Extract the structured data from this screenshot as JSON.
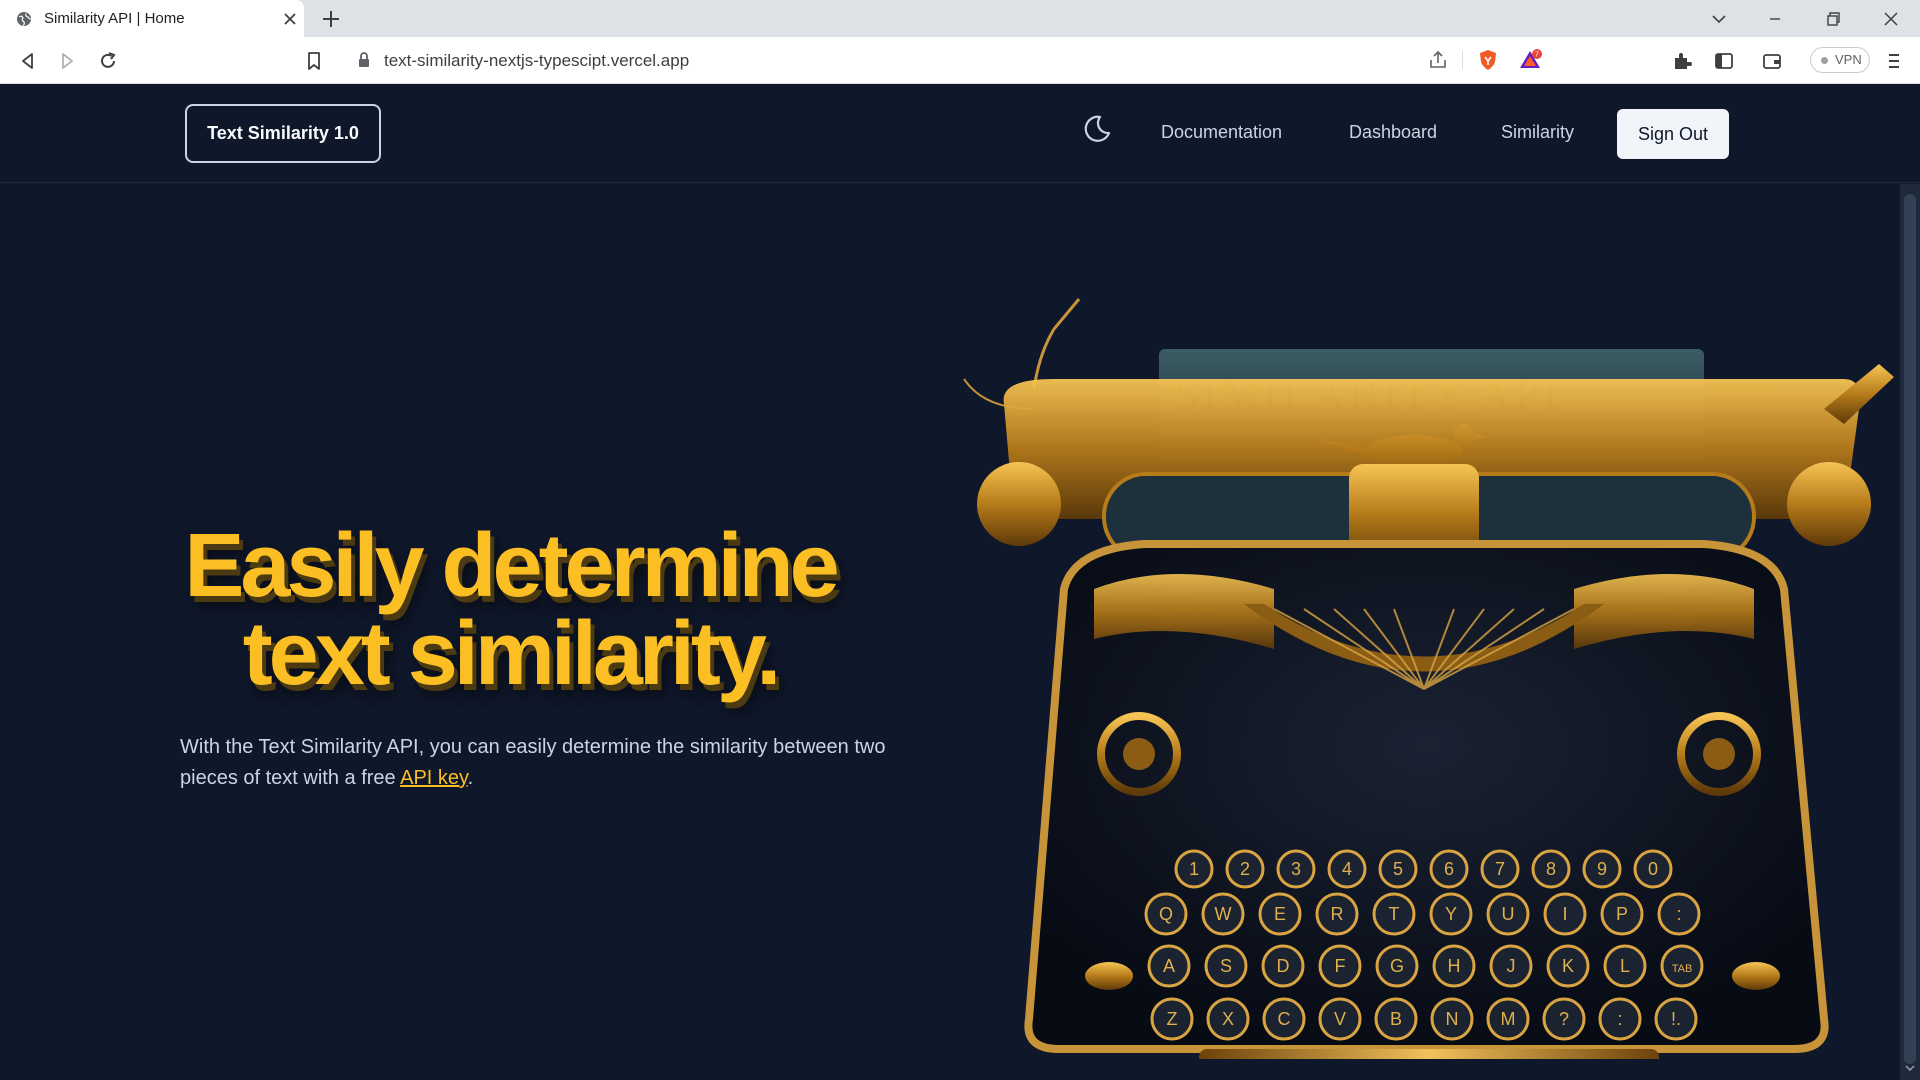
{
  "browser": {
    "tab_title": "Similarity API | Home",
    "url": "text-similarity-nextjs-typescipt.vercel.app",
    "vpn_label": "VPN",
    "icons": [
      "globe-icon",
      "close-icon",
      "plus-icon",
      "chevron-down-icon",
      "minimize-icon",
      "restore-icon",
      "back-icon",
      "forward-icon",
      "reload-icon",
      "bookmark-icon",
      "lock-icon",
      "share-icon",
      "brave-shield-icon",
      "brave-rewards-icon",
      "extensions-icon",
      "sidebar-icon",
      "wallet-icon",
      "menu-icon"
    ]
  },
  "nav": {
    "brand": "Text Similarity 1.0",
    "links": [
      "Documentation",
      "Dashboard",
      "Similarity"
    ],
    "sign_out": "Sign Out"
  },
  "hero": {
    "headline_line1": "Easily determine",
    "headline_line2": "text similarity.",
    "subtext_before": "With the Text Similarity API, you can easily determine the similarity between two pieces of text with a free ",
    "subtext_link": "API key",
    "subtext_after": ".",
    "paper_text": "SIMILARITY API",
    "keys_row1": [
      "1",
      "2",
      "3",
      "4",
      "5",
      "6",
      "7",
      "8",
      "9",
      "0"
    ],
    "keys_row2": [
      "Q",
      "W",
      "E",
      "R",
      "T",
      "Y",
      "U",
      "I",
      "P",
      ":"
    ],
    "keys_row3": [
      "A",
      "S",
      "D",
      "F",
      "G",
      "H",
      "J",
      "K",
      "L",
      "TAB"
    ],
    "keys_row4": [
      "Z",
      "X",
      "C",
      "V",
      "B",
      "N",
      "M",
      "?",
      ":",
      "!."
    ]
  },
  "colors": {
    "page_bg": "#0f172a",
    "accent": "#fbbf24",
    "text": "#cbd5e1"
  }
}
